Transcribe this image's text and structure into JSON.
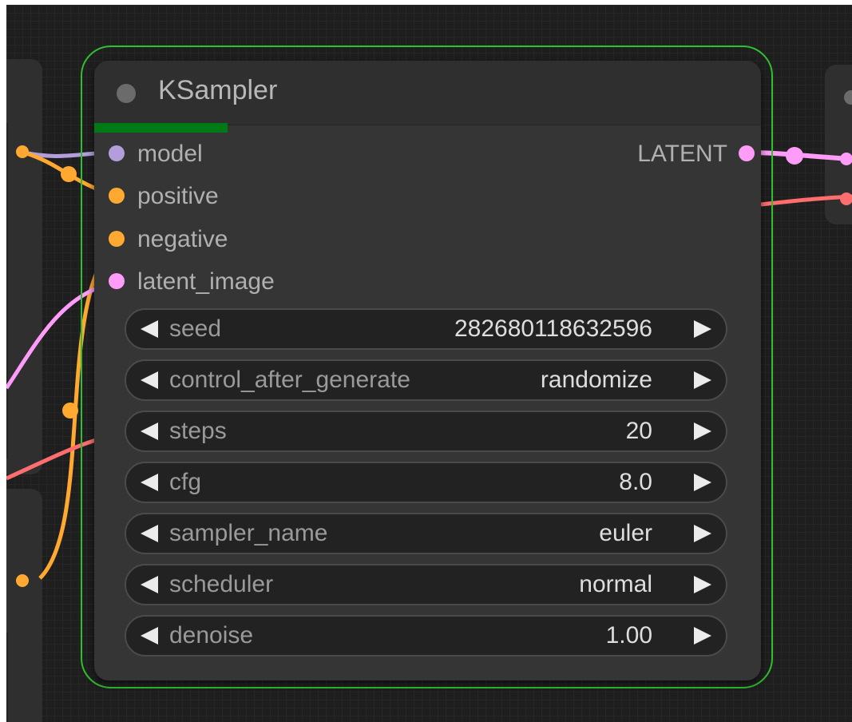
{
  "node": {
    "title": "KSampler",
    "progress_fraction": 0.2,
    "inputs": [
      {
        "label": "model",
        "color": "#b39ddb"
      },
      {
        "label": "positive",
        "color": "#ffa931"
      },
      {
        "label": "negative",
        "color": "#ffa931"
      },
      {
        "label": "latent_image",
        "color": "#ff9cf9"
      }
    ],
    "outputs": [
      {
        "label": "LATENT",
        "color": "#ff9cf9"
      }
    ],
    "widgets": [
      {
        "name": "seed",
        "value": "282680118632596"
      },
      {
        "name": "control_after_generate",
        "value": "randomize"
      },
      {
        "name": "steps",
        "value": "20"
      },
      {
        "name": "cfg",
        "value": "8.0"
      },
      {
        "name": "sampler_name",
        "value": "euler"
      },
      {
        "name": "scheduler",
        "value": "normal"
      },
      {
        "name": "denoise",
        "value": "1.00"
      }
    ]
  },
  "colors": {
    "selection_outline": "#2fbf2f",
    "progress_bar": "#007a16",
    "conditioning_wire": "#ffa931",
    "latent_wire": "#ff9cf9",
    "model_wire": "#b39ddb",
    "vae_wire": "#ff6e6e",
    "canvas": "#1e1e1e"
  }
}
